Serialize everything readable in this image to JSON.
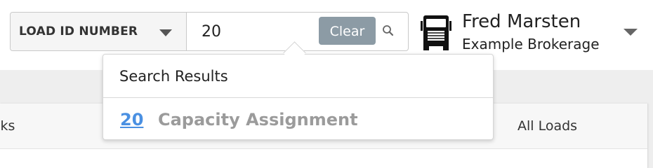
{
  "search": {
    "type_label": "LOAD ID NUMBER",
    "query": "20",
    "clear_label": "Clear"
  },
  "user": {
    "name": "Fred Marsten",
    "company": "Example Brokerage"
  },
  "dropdown": {
    "heading": "Search Results",
    "results": [
      {
        "id": "20",
        "type": "Capacity Assignment"
      }
    ]
  },
  "tabs": {
    "left_partial": "cks",
    "right": "All Loads"
  },
  "colors": {
    "clear_button": "#8c9ba5",
    "result_link": "#4a90e2",
    "result_type": "#9b9b9b"
  },
  "icons": {
    "search": "search-icon",
    "truck": "truck-icon",
    "caret": "chevron-down-icon"
  }
}
